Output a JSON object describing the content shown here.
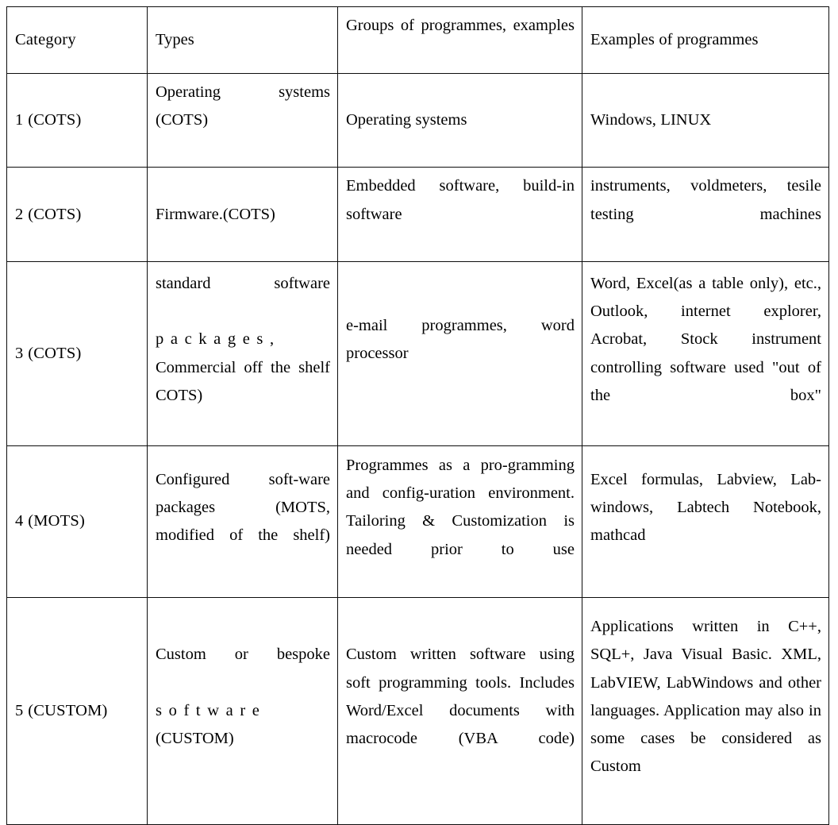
{
  "table": {
    "columns": [
      {
        "key": "category",
        "header": "Category"
      },
      {
        "key": "types",
        "header": "Types"
      },
      {
        "key": "groups",
        "header": "Groups of programmes, examples"
      },
      {
        "key": "examples",
        "header": "Examples of programmes"
      }
    ],
    "rows": [
      {
        "category": "1 (COTS)",
        "types": "Operating systems (COTS)",
        "groups": "Operating systems",
        "examples": "Windows, LINUX"
      },
      {
        "category": "2 (COTS)",
        "types": "Firmware.(COTS)",
        "groups": "Embedded software, build-in software",
        "examples": "instruments, voldmeters, tesile testing machines"
      },
      {
        "category": "3 (COTS)",
        "types_line1": "standard software",
        "types_line2": "packages,",
        "types_line3": "Commercial off the shelf COTS)",
        "types": "standard software p a c k a g e s , Commercial off the shelf COTS)",
        "groups": "e-mail programmes, word processor",
        "examples": "Word, Excel(as a table only), etc., Outlook, internet explorer, Acrobat, Stock instrument controlling software used \"out of the box\""
      },
      {
        "category": "4 (MOTS)",
        "types": "Configured soft-ware packages (MOTS, modified of the shelf)",
        "groups": "Programmes as a pro-gramming and config-uration environment. Tailoring & Customization is needed prior to use",
        "examples": "Excel formulas, Labview, Lab-windows, Labtech Notebook, mathcad"
      },
      {
        "category": "5 (CUSTOM)",
        "types_line1": "Custom or bespoke",
        "types_line2": "software",
        "types_line3": "(CUSTOM)",
        "types": "Custom or bespoke s o f t w a r e (CUSTOM)",
        "groups": "Custom written software using soft programming tools. Includes Word/Excel documents with macrocode (VBA code)",
        "examples": "Applications written in C++, SQL+, Java Visual Basic. XML, LabVIEW, LabWindows and other languages. Application may also in some cases be considered as Custom"
      }
    ]
  },
  "colors": {
    "border": "#0d0d0d",
    "text": "#000000",
    "background": "#ffffff"
  }
}
